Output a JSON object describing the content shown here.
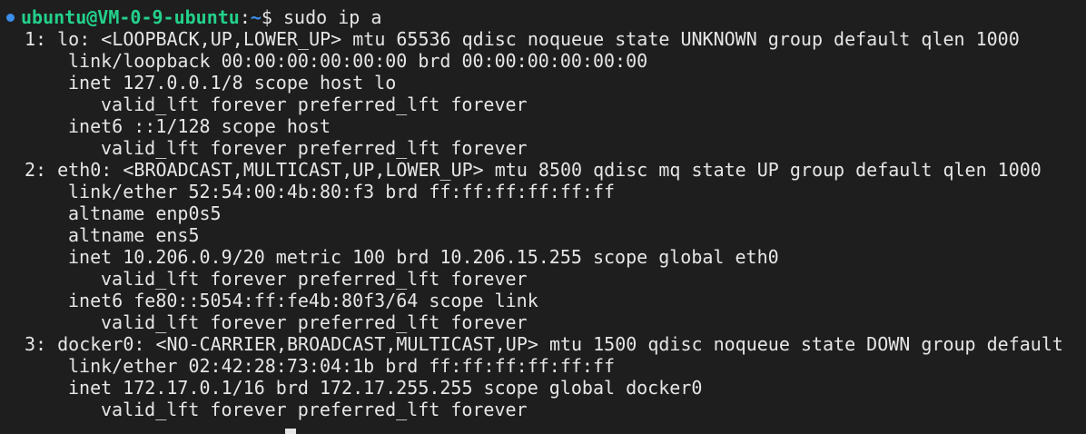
{
  "prompt": {
    "user_host": "ubuntu@VM-0-9-ubuntu",
    "separator": ":",
    "path": "~",
    "symbol": "$",
    "command": " sudo ip a"
  },
  "output": [
    {
      "indent": 0,
      "text": "1: lo: <LOOPBACK,UP,LOWER_UP> mtu 65536 qdisc noqueue state UNKNOWN group default qlen 1000"
    },
    {
      "indent": 1,
      "text": "link/loopback 00:00:00:00:00:00 brd 00:00:00:00:00:00"
    },
    {
      "indent": 1,
      "text": "inet 127.0.0.1/8 scope host lo"
    },
    {
      "indent": 2,
      "text": "valid_lft forever preferred_lft forever"
    },
    {
      "indent": 1,
      "text": "inet6 ::1/128 scope host"
    },
    {
      "indent": 2,
      "text": "valid_lft forever preferred_lft forever"
    },
    {
      "indent": 0,
      "text": "2: eth0: <BROADCAST,MULTICAST,UP,LOWER_UP> mtu 8500 qdisc mq state UP group default qlen 1000"
    },
    {
      "indent": 1,
      "text": "link/ether 52:54:00:4b:80:f3 brd ff:ff:ff:ff:ff:ff"
    },
    {
      "indent": 1,
      "text": "altname enp0s5"
    },
    {
      "indent": 1,
      "text": "altname ens5"
    },
    {
      "indent": 1,
      "text": "inet 10.206.0.9/20 metric 100 brd 10.206.15.255 scope global eth0"
    },
    {
      "indent": 2,
      "text": "valid_lft forever preferred_lft forever"
    },
    {
      "indent": 1,
      "text": "inet6 fe80::5054:ff:fe4b:80f3/64 scope link"
    },
    {
      "indent": 2,
      "text": "valid_lft forever preferred_lft forever"
    },
    {
      "indent": 0,
      "text": "3: docker0: <NO-CARRIER,BROADCAST,MULTICAST,UP> mtu 1500 qdisc noqueue state DOWN group default"
    },
    {
      "indent": 1,
      "text": "link/ether 02:42:28:73:04:1b brd ff:ff:ff:ff:ff:ff"
    },
    {
      "indent": 1,
      "text": "inet 172.17.0.1/16 brd 172.17.255.255 scope global docker0"
    },
    {
      "indent": 2,
      "text": "valid_lft forever preferred_lft forever"
    }
  ],
  "colors": {
    "background": "#1e1e1e",
    "text": "#e6e6e6",
    "user_host": "#23d18b",
    "path": "#3b8eea",
    "status_dot": "#3b8eea"
  }
}
